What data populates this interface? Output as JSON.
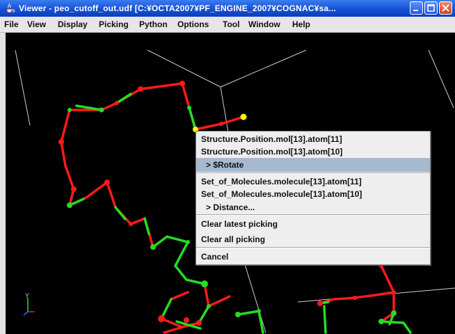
{
  "window": {
    "title": "Viewer - peo_cutoff_out.udf [C:¥OCTA2007¥PF_ENGINE_2007¥COGNAC¥sa...",
    "app_icon": "java-cup-icon",
    "controls": [
      "minimize-icon",
      "maximize-icon",
      "close-icon"
    ]
  },
  "menubar": {
    "items": [
      "File",
      "View",
      "Display",
      "Picking",
      "Python",
      "Options",
      "Tool",
      "Window",
      "Help"
    ]
  },
  "canvas": {
    "background": "#000000",
    "bond_colors": [
      "#ff1a1a",
      "#22dd22"
    ],
    "picked_atom_color": "#ffff00",
    "axes_icon": "xyz-axes-icon"
  },
  "popup_menu": {
    "items": [
      "Structure.Position.mol[13].atom[11]",
      "Structure.Position.mol[13].atom[10]",
      "> $Rotate",
      "Set_of_Molecules.molecule[13].atom[11]",
      "Set_of_Molecules.molecule[13].atom[10]",
      "> Distance...",
      "Clear latest picking",
      "Clear all picking",
      "Cancel"
    ],
    "highlighted": "> $Rotate"
  }
}
